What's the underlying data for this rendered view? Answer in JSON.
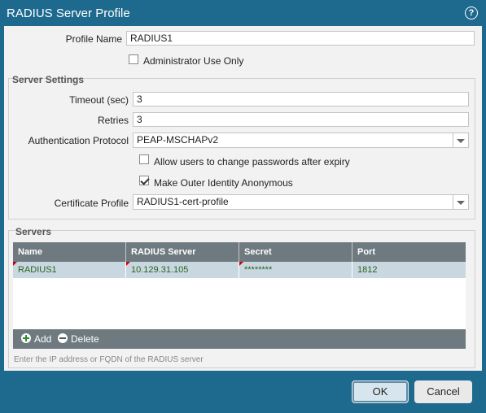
{
  "window": {
    "title": "RADIUS Server Profile",
    "help_icon": "?"
  },
  "form": {
    "profile_name_label": "Profile Name",
    "profile_name_value": "RADIUS1",
    "admin_use_only_label": "Administrator Use Only",
    "admin_use_only_checked": false
  },
  "server_settings": {
    "legend": "Server Settings",
    "timeout_label": "Timeout (sec)",
    "timeout_value": "3",
    "retries_label": "Retries",
    "retries_value": "3",
    "auth_protocol_label": "Authentication Protocol",
    "auth_protocol_value": "PEAP-MSCHAPv2",
    "allow_change_pw_label": "Allow users to change passwords after expiry",
    "allow_change_pw_checked": false,
    "outer_identity_label": "Make Outer Identity Anonymous",
    "outer_identity_checked": true,
    "cert_profile_label": "Certificate Profile",
    "cert_profile_value": "RADIUS1-cert-profile"
  },
  "servers": {
    "legend": "Servers",
    "columns": [
      "Name",
      "RADIUS Server",
      "Secret",
      "Port"
    ],
    "rows": [
      {
        "name": "RADIUS1",
        "server": "10.129.31.105",
        "secret": "********",
        "port": "1812"
      }
    ],
    "add_label": "Add",
    "delete_label": "Delete",
    "hint": "Enter the IP address or FQDN of the RADIUS server"
  },
  "buttons": {
    "ok": "OK",
    "cancel": "Cancel"
  }
}
